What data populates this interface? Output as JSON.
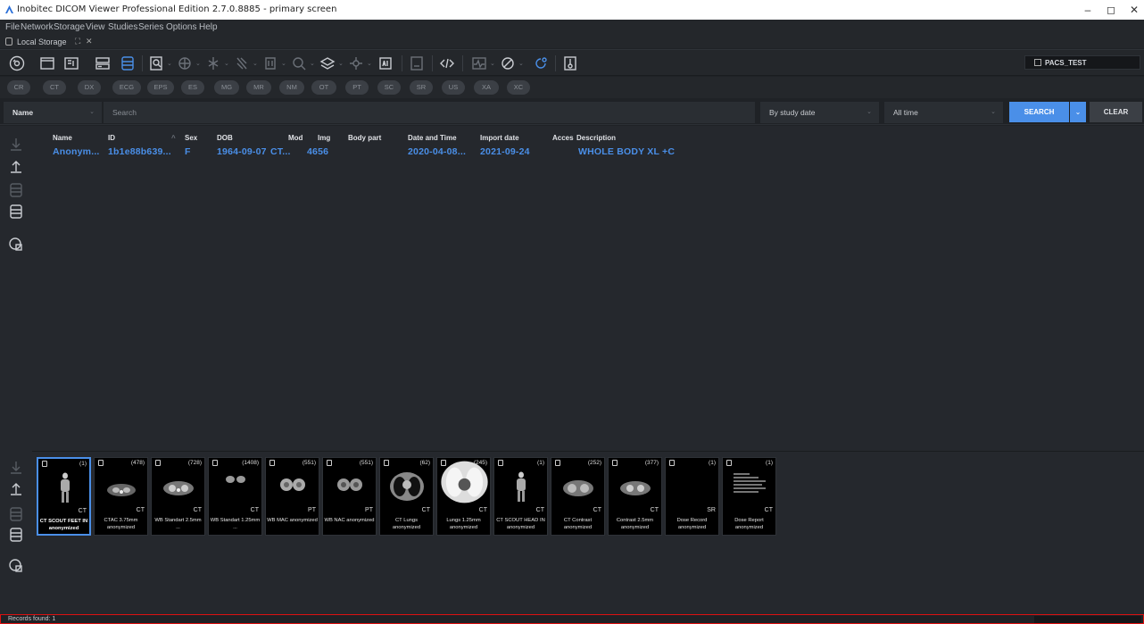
{
  "window": {
    "title": "Inobitec DICOM Viewer Professional Edition 2.7.0.8885 - primary screen",
    "minimize": "–",
    "maximize": "◻",
    "close": "✕"
  },
  "menu": [
    "File",
    "Network",
    "Storage",
    "View",
    "Studies",
    "Series",
    "Options",
    "Help"
  ],
  "tab": {
    "label": "Local Storage",
    "close": "✕",
    "float": "⛶"
  },
  "pacs": {
    "label": "PACS_TEST"
  },
  "modalities": [
    "CR",
    "CT",
    "DX",
    "ECG",
    "EPS",
    "ES",
    "MG",
    "MR",
    "NM",
    "OT",
    "PT",
    "SC",
    "SR",
    "US",
    "XA",
    "XC"
  ],
  "filter": {
    "name_field": "Name",
    "search_placeholder": "Search",
    "date_mode": "By study date",
    "time_range": "All time",
    "search_button": "SEARCH",
    "clear_button": "CLEAR"
  },
  "table": {
    "headers": [
      "Name",
      "ID",
      "Sex",
      "DOB",
      "Mod",
      "Img",
      "Body part",
      "Date and Time",
      "Import date",
      "Acces",
      "Description"
    ],
    "sort_indicator": "^",
    "rows": [
      {
        "name": "Anonym...",
        "id": "1b1e88b639...",
        "sex": "F",
        "dob": "1964-09-07",
        "mod": "CT...",
        "img": "4656",
        "body_part": "",
        "date_time": "2020-04-08...",
        "import_date": "2021-09-24",
        "acces": "",
        "description": "WHOLE BODY XL +C"
      }
    ]
  },
  "series": [
    {
      "count": "(1)",
      "mod": "CT",
      "caption": "CT SCOUT FEET IN anonymized",
      "selected": true,
      "icon": "body-scout"
    },
    {
      "count": "(478)",
      "mod": "CT",
      "caption": "CTAC 3.75mm anonymized",
      "icon": "axial-ct"
    },
    {
      "count": "(728)",
      "mod": "CT",
      "caption": "WB Standart 2.5mm ...",
      "icon": "axial-ct"
    },
    {
      "count": "(1408)",
      "mod": "CT",
      "caption": "WB Standart 1.25mm ...",
      "icon": "axial-ct-small"
    },
    {
      "count": "(551)",
      "mod": "PT",
      "caption": "WB MAC anonymized",
      "icon": "pet-axial"
    },
    {
      "count": "(551)",
      "mod": "PT",
      "caption": "WB NAC anonymized",
      "icon": "pet-axial"
    },
    {
      "count": "(62)",
      "mod": "CT",
      "caption": "CT Lungs anonymized",
      "icon": "chest-ct"
    },
    {
      "count": "(245)",
      "mod": "CT",
      "caption": "Lungs 1.25mm anonymized",
      "icon": "lungs-ct"
    },
    {
      "count": "(1)",
      "mod": "CT",
      "caption": "CT SCOUT HEAD IN anonymized",
      "icon": "body-scout"
    },
    {
      "count": "(252)",
      "mod": "CT",
      "caption": "CT Contrast anonymized",
      "icon": "axial-ct"
    },
    {
      "count": "(377)",
      "mod": "CT",
      "caption": "Contrast 2.5mm anonymized",
      "icon": "axial-ct"
    },
    {
      "count": "(1)",
      "mod": "SR",
      "caption": "Dose Record anonymized",
      "icon": "blank"
    },
    {
      "count": "(1)",
      "mod": "CT",
      "caption": "Dose Report anonymized",
      "icon": "report"
    }
  ],
  "status": {
    "records": "Records found: 1"
  },
  "colors": {
    "accent": "#4a8fe8",
    "background": "#1f2226",
    "panel": "#25282d",
    "status_border": "#dd1111"
  }
}
